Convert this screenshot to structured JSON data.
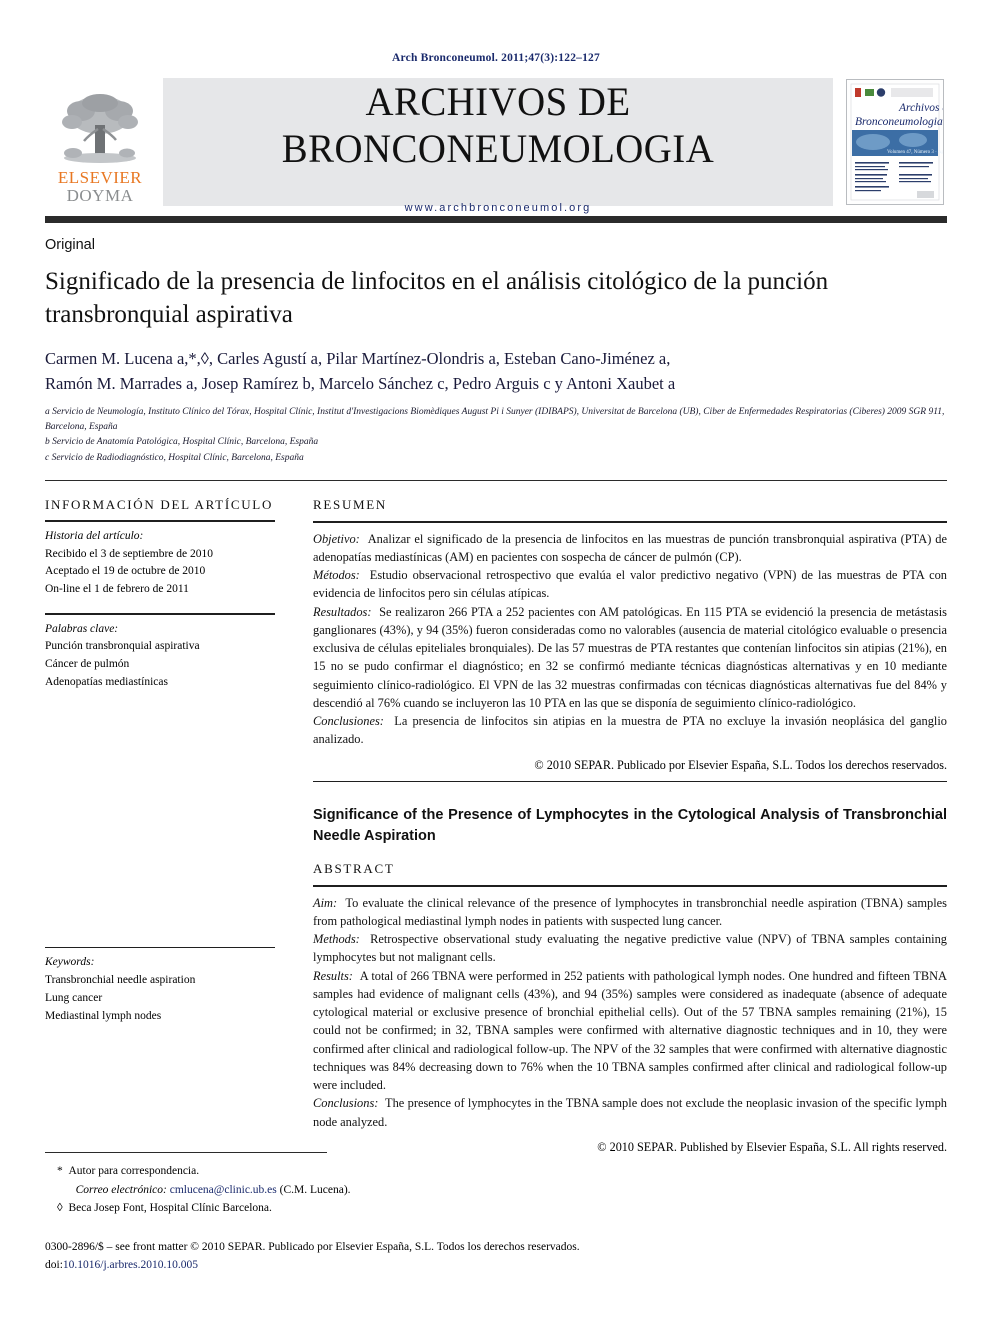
{
  "running_head": "Arch Bronconeumol. 2011;47(3):122–127",
  "masthead": {
    "publisher_line1": "ELSEVIER",
    "publisher_line2": "DOYMA",
    "journal_title": "ARCHIVOS DE BRONCONEUMOLOGIA",
    "journal_url": "www.archbronconeumol.org",
    "cover_title_line1": "Archivos de",
    "cover_title_line2": "Bronconeumologia"
  },
  "article": {
    "kind": "Original",
    "title": "Significado de la presencia de linfocitos en el análisis citológico de la punción transbronquial aspirativa",
    "authors_line1": "Carmen M. Lucena a,*,◊,  Carles Agustí a,  Pilar Martínez-Olondris a,  Esteban Cano-Jiménez a,",
    "authors_line2": "Ramón M. Marrades a,  Josep Ramírez b,  Marcelo Sánchez c,  Pedro Arguis c y  Antoni Xaubet a",
    "affiliations": [
      "a Servicio de Neumología, Instituto Clínico del Tórax, Hospital Clínic, Institut d'Investigacions Biomèdiques August Pi i Sunyer (IDIBAPS), Universitat de Barcelona (UB), Ciber de Enfermedades Respiratorias (Ciberes) 2009 SGR 911, Barcelona, España",
      "b Servicio de Anatomía Patológica, Hospital Clínic, Barcelona, España",
      "c Servicio de Radiodiagnóstico, Hospital Clínic, Barcelona, España"
    ]
  },
  "sidebar": {
    "info_label": "INFORMACIÓN DEL ARTÍCULO",
    "history_label": "Historia del artículo:",
    "history_lines": [
      "Recibido el 3 de septiembre de 2010",
      "Aceptado el 19 de octubre de 2010",
      "On-line el 1 de febrero de 2011"
    ],
    "keywords_es_label": "Palabras clave:",
    "keywords_es": [
      "Punción transbronquial aspirativa",
      "Cáncer de pulmón",
      "Adenopatías mediastínicas"
    ],
    "keywords_en_label": "Keywords:",
    "keywords_en": [
      "Transbronchial needle aspiration",
      "Lung cancer",
      "Mediastinal lymph nodes"
    ]
  },
  "resumen": {
    "label": "RESUMEN",
    "objetivo_label": "Objetivo:",
    "objetivo_text": "Analizar el significado de la presencia de linfocitos en las muestras de punción transbronquial aspirativa (PTA) de adenopatías mediastínicas (AM) en pacientes con sospecha de cáncer de pulmón (CP).",
    "metodos_label": "Métodos:",
    "metodos_text": "Estudio observacional retrospectivo que evalúa el valor predictivo negativo (VPN) de las muestras de PTA con evidencia de linfocitos pero sin células atípicas.",
    "resultados_label": "Resultados:",
    "resultados_text": "Se realizaron 266 PTA a 252 pacientes con AM patológicas. En 115 PTA se evidenció la presencia de metástasis ganglionares (43%), y 94 (35%) fueron consideradas como no valorables (ausencia de material citológico evaluable o presencia exclusiva de células epiteliales bronquiales). De las 57 muestras de PTA restantes que contenían linfocitos sin atipias (21%), en 15 no se pudo confirmar el diagnóstico; en 32 se confirmó mediante técnicas diagnósticas alternativas y en 10 mediante seguimiento clínico-radiológico. El VPN de las 32 muestras confirmadas con técnicas diagnósticas alternativas fue del 84% y descendió al 76% cuando se incluyeron las 10 PTA en las que se disponía de seguimiento clínico-radiológico.",
    "conclusiones_label": "Conclusiones:",
    "conclusiones_text": "La presencia de linfocitos sin atipias en la muestra de PTA no excluye la invasión neoplásica del ganglio analizado.",
    "copyright": "© 2010 SEPAR. Publicado por Elsevier España, S.L. Todos los derechos reservados."
  },
  "abstract": {
    "title": "Significance of the Presence of Lymphocytes in the Cytological Analysis of Transbronchial Needle Aspiration",
    "label": "ABSTRACT",
    "aim_label": "Aim:",
    "aim_text": "To evaluate the clinical relevance of the presence of lymphocytes in transbronchial needle aspiration (TBNA) samples from pathological mediastinal lymph nodes in patients with suspected lung cancer.",
    "methods_label": "Methods:",
    "methods_text": "Retrospective observational study evaluating the negative predictive value (NPV) of TBNA samples containing lymphocytes but not malignant cells.",
    "results_label": "Results:",
    "results_text": "A total of 266 TBNA were performed in 252 patients with pathological lymph nodes. One hundred and fifteen TBNA samples had evidence of malignant cells (43%), and 94 (35%) samples were considered as inadequate (absence of adequate cytological material or exclusive presence of bronchial epithelial cells). Out of the 57 TBNA samples remaining (21%), 15 could not be confirmed; in 32, TBNA samples were confirmed with alternative diagnostic techniques and in 10, they were confirmed after clinical and radiological follow-up. The NPV of the 32 samples that were confirmed with alternative diagnostic techniques was 84% decreasing down to 76% when the 10 TBNA samples confirmed after clinical and radiological follow-up were included.",
    "conclusions_label": "Conclusions:",
    "conclusions_text": "The presence of lymphocytes in the TBNA sample does not exclude the neoplasic invasion of the specific lymph node analyzed.",
    "copyright": "© 2010 SEPAR. Published by Elsevier España, S.L. All rights reserved."
  },
  "footnotes": {
    "star_marker": "*",
    "star_text": "Autor para correspondencia.",
    "email_label": "Correo electrónico:",
    "email": "cmlucena@clinic.ub.es",
    "email_suffix": "(C.M. Lucena).",
    "diamond_marker": "◊",
    "diamond_text": "Beca Josep Font, Hospital Clínic Barcelona."
  },
  "imprint": {
    "line1": "0300-2896/$ – see front matter © 2010 SEPAR. Publicado por Elsevier España, S.L. Todos los derechos reservados.",
    "doi_prefix": "doi:",
    "doi": "10.1016/j.arbres.2010.10.005"
  },
  "colors": {
    "accent_blue": "#1a2a6c",
    "elsevier_orange": "#E87722",
    "band_gray": "#e6e7e9",
    "rule_dark": "#2b2b2b"
  }
}
